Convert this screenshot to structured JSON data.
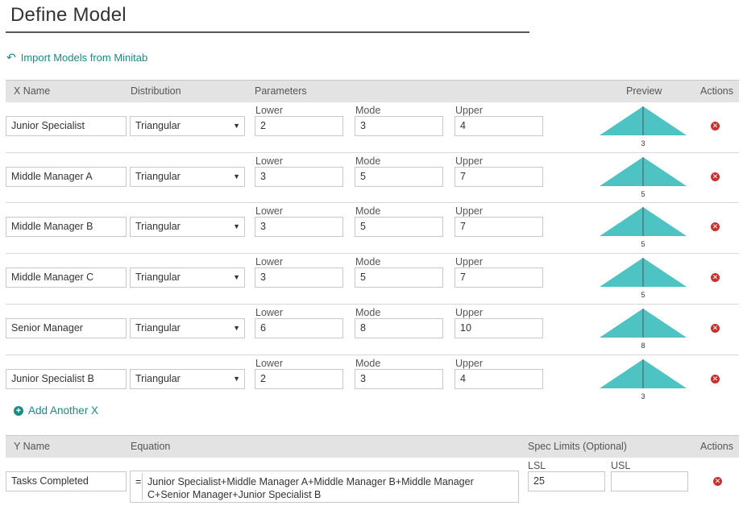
{
  "page": {
    "title": "Define Model"
  },
  "import_link": {
    "label": "Import Models from Minitab",
    "icon": "undo-arrow-icon"
  },
  "x_table": {
    "headers": {
      "name": "X Name",
      "distribution": "Distribution",
      "parameters": "Parameters",
      "preview": "Preview",
      "actions": "Actions"
    },
    "rows": [
      {
        "name": "Junior Specialist",
        "distribution": "Triangular",
        "lower_label": "Lower",
        "mode_label": "Mode",
        "upper_label": "Upper",
        "lower": "2",
        "mode": "3",
        "upper": "4",
        "preview_label": "3"
      },
      {
        "name": "Middle Manager A",
        "distribution": "Triangular",
        "lower_label": "Lower",
        "mode_label": "Mode",
        "upper_label": "Upper",
        "lower": "3",
        "mode": "5",
        "upper": "7",
        "preview_label": "5"
      },
      {
        "name": "Middle Manager B",
        "distribution": "Triangular",
        "lower_label": "Lower",
        "mode_label": "Mode",
        "upper_label": "Upper",
        "lower": "3",
        "mode": "5",
        "upper": "7",
        "preview_label": "5"
      },
      {
        "name": "Middle Manager C",
        "distribution": "Triangular",
        "lower_label": "Lower",
        "mode_label": "Mode",
        "upper_label": "Upper",
        "lower": "3",
        "mode": "5",
        "upper": "7",
        "preview_label": "5"
      },
      {
        "name": "Senior Manager",
        "distribution": "Triangular",
        "lower_label": "Lower",
        "mode_label": "Mode",
        "upper_label": "Upper",
        "lower": "6",
        "mode": "8",
        "upper": "10",
        "preview_label": "8"
      },
      {
        "name": "Junior Specialist B",
        "distribution": "Triangular",
        "lower_label": "Lower",
        "mode_label": "Mode",
        "upper_label": "Upper",
        "lower": "2",
        "mode": "3",
        "upper": "4",
        "preview_label": "3"
      }
    ]
  },
  "add_x": {
    "label": "Add Another X",
    "icon": "plus-circle-icon"
  },
  "y_table": {
    "headers": {
      "name": "Y Name",
      "equation": "Equation",
      "spec_limits": "Spec Limits (Optional)",
      "actions": "Actions"
    },
    "row": {
      "name": "Tasks Completed",
      "equals": "=",
      "equation": "Junior Specialist+Middle Manager A+Middle Manager B+Middle Manager C+Senior Manager+Junior Specialist B",
      "lsl_label": "LSL",
      "usl_label": "USL",
      "lsl": "25",
      "usl": ""
    }
  },
  "colors": {
    "accent": "#1a8a82",
    "preview_fill": "#4ec3c3",
    "remove": "#c9302c",
    "header_bg": "#e3e3e3"
  }
}
